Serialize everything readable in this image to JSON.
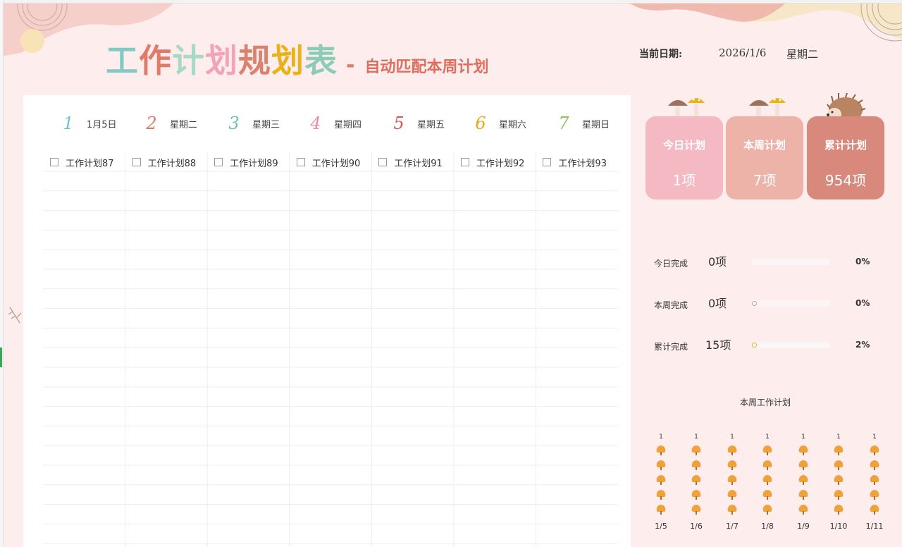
{
  "title": {
    "main_chars": [
      {
        "ch": "工",
        "color": "#85c9c4"
      },
      {
        "ch": "作",
        "color": "#e07a6a"
      },
      {
        "ch": "计",
        "color": "#a8d8c7"
      },
      {
        "ch": "划",
        "color": "#f2a3b5"
      },
      {
        "ch": "规",
        "color": "#d9826e"
      },
      {
        "ch": "划",
        "color": "#e8b21a"
      },
      {
        "ch": "表",
        "color": "#8ccbb8"
      }
    ],
    "dash": "-",
    "subtitle": "自动匹配本周计划"
  },
  "date": {
    "label": "当前日期:",
    "value": "2026/1/6",
    "weekday": "星期二"
  },
  "days": [
    {
      "num": "1",
      "label": "1月5日",
      "color": "#6fc3d3"
    },
    {
      "num": "2",
      "label": "星期二",
      "color": "#e0786a"
    },
    {
      "num": "3",
      "label": "星期三",
      "color": "#74c2a3"
    },
    {
      "num": "4",
      "label": "星期四",
      "color": "#f08aa0"
    },
    {
      "num": "5",
      "label": "星期五",
      "color": "#e0584e"
    },
    {
      "num": "6",
      "label": "星期六",
      "color": "#eaa81e"
    },
    {
      "num": "7",
      "label": "星期日",
      "color": "#8ac85a"
    }
  ],
  "plan_columns": [
    "工作计划87",
    "工作计划88",
    "工作计划89",
    "工作计划90",
    "工作计划91",
    "工作计划92",
    "工作计划93"
  ],
  "cards": [
    {
      "title": "今日计划",
      "value": "1项",
      "color": "#f4b9c3"
    },
    {
      "title": "本周计划",
      "value": "7项",
      "color": "#eeb3a8"
    },
    {
      "title": "累计计划",
      "value": "954项",
      "color": "#d9897c"
    }
  ],
  "progress": [
    {
      "label": "今日完成",
      "count": "0项",
      "pct": "0%",
      "fraction": 0.0,
      "dot_color": ""
    },
    {
      "label": "本周完成",
      "count": "0项",
      "pct": "0%",
      "fraction": 0.0,
      "dot_color": "#f08aa0"
    },
    {
      "label": "累计完成",
      "count": "15项",
      "pct": "2%",
      "fraction": 0.02,
      "dot_color": "#eaa81e"
    }
  ],
  "chart_data": {
    "type": "bar",
    "title": "本周工作计划",
    "categories": [
      "1/5",
      "1/6",
      "1/7",
      "1/8",
      "1/9",
      "1/10",
      "1/11"
    ],
    "values": [
      1,
      1,
      1,
      1,
      1,
      1,
      1
    ],
    "icon_rows": 5,
    "icon": "tree-icon",
    "icon_color": "#f0a23a"
  }
}
